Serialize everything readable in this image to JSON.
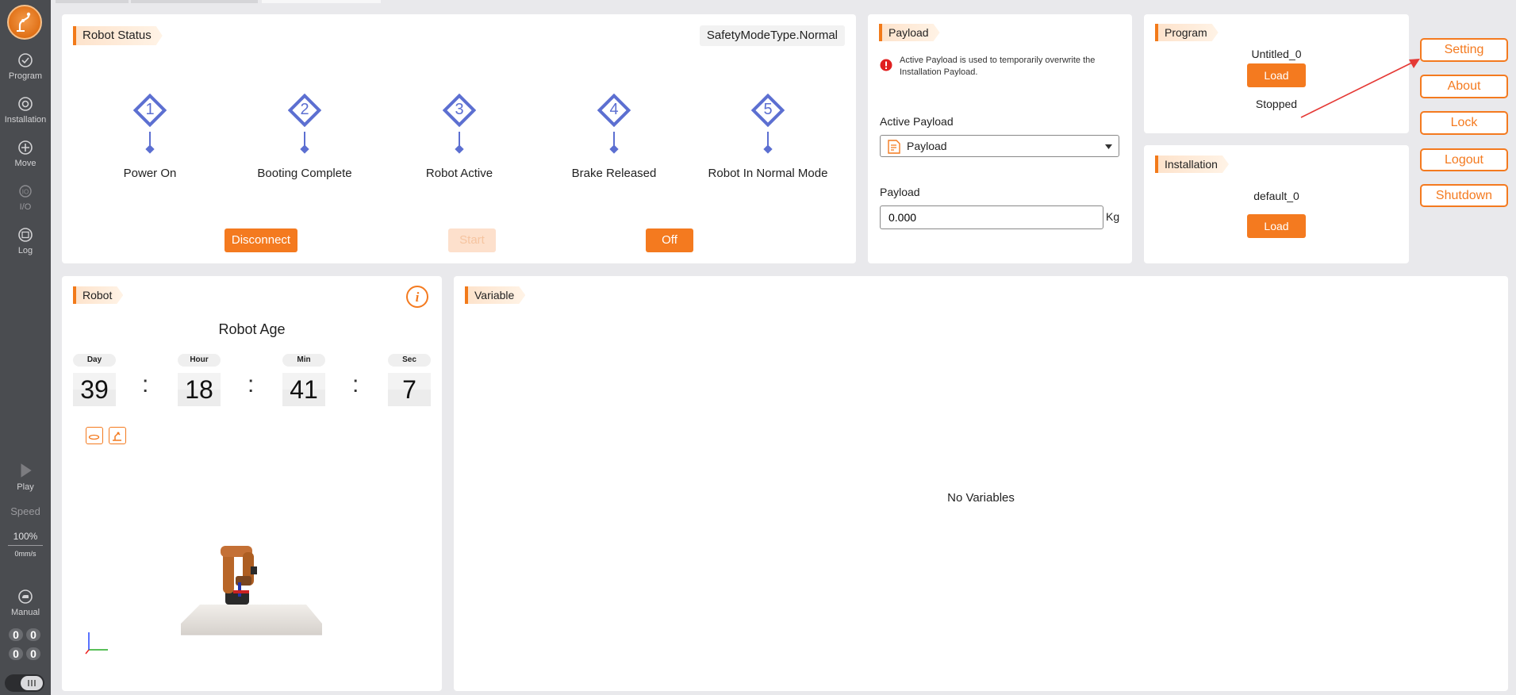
{
  "sidebar": {
    "items": [
      {
        "label": "Program",
        "icon": "program-icon"
      },
      {
        "label": "Installation",
        "icon": "installation-icon"
      },
      {
        "label": "Move",
        "icon": "move-icon"
      },
      {
        "label": "I/O",
        "icon": "io-icon"
      },
      {
        "label": "Log",
        "icon": "log-icon"
      }
    ],
    "play_label": "Play",
    "speed_label": "Speed",
    "speed_percent": "100%",
    "speed_value": "0mm/s",
    "manual_label": "Manual",
    "digit_rows": [
      [
        "0",
        "0"
      ],
      [
        "0",
        "0"
      ]
    ]
  },
  "robot_status": {
    "title": "Robot Status",
    "safety_mode": "SafetyModeType.Normal",
    "steps": [
      {
        "num": "1",
        "label": "Power On"
      },
      {
        "num": "2",
        "label": "Booting Complete"
      },
      {
        "num": "3",
        "label": "Robot Active"
      },
      {
        "num": "4",
        "label": "Brake Released"
      },
      {
        "num": "5",
        "label": "Robot In Normal Mode"
      }
    ],
    "disconnect_label": "Disconnect",
    "start_label": "Start",
    "off_label": "Off"
  },
  "payload": {
    "title": "Payload",
    "notice": "Active Payload is used to temporarily overwrite the Installation Payload.",
    "active_label": "Active Payload",
    "active_value": "Payload",
    "payload_label": "Payload",
    "payload_value": "0.000",
    "unit": "Kg"
  },
  "program": {
    "title": "Program",
    "name": "Untitled_0",
    "load_label": "Load",
    "state": "Stopped"
  },
  "installation": {
    "title": "Installation",
    "name": "default_0",
    "load_label": "Load"
  },
  "actions": {
    "setting": "Setting",
    "about": "About",
    "lock": "Lock",
    "logout": "Logout",
    "shutdown": "Shutdown"
  },
  "robot": {
    "title": "Robot",
    "age_title": "Robot Age",
    "age": [
      {
        "unit": "Day",
        "value": "39"
      },
      {
        "unit": "Hour",
        "value": "18"
      },
      {
        "unit": "Min",
        "value": "41"
      },
      {
        "unit": "Sec",
        "value": "7"
      }
    ],
    "separator": ":"
  },
  "variable": {
    "title": "Variable",
    "empty_text": "No Variables"
  },
  "colors": {
    "accent": "#f47a1f",
    "step_blue": "#5c6fd1",
    "sidebar_bg": "#4a4c50"
  }
}
